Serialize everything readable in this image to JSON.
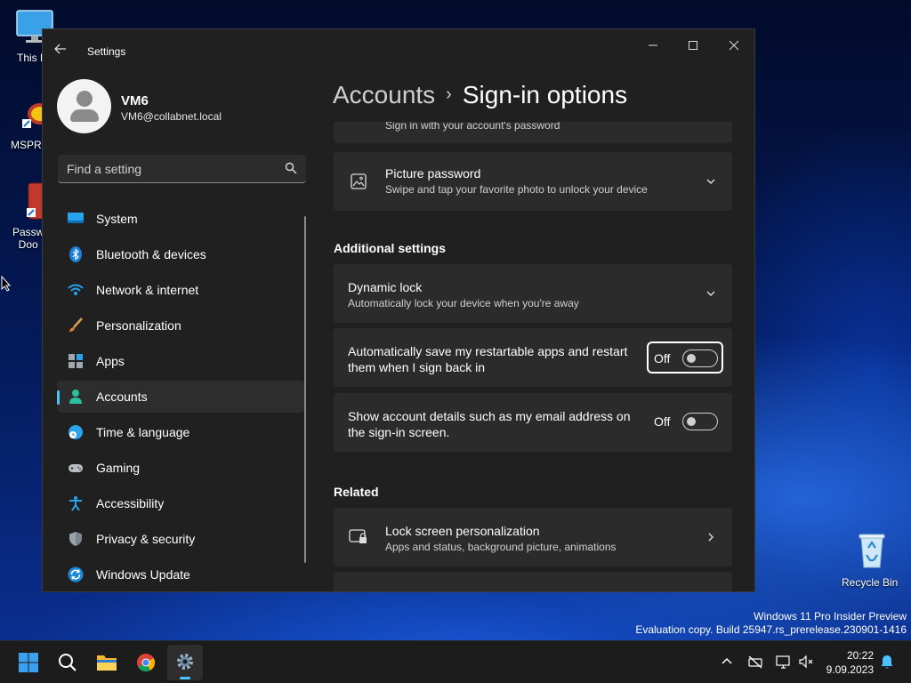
{
  "desktop": {
    "icons": [
      {
        "label": "This PC"
      },
      {
        "label": "MSPRe"
      },
      {
        "label": "Passw\nDoo"
      },
      {
        "label": "Recycle Bin"
      }
    ],
    "watermark_line1": "Windows 11 Pro Insider Preview",
    "watermark_line2": "Evaluation copy. Build 25947.rs_prerelease.230901-1416"
  },
  "window": {
    "app_title": "Settings",
    "controls": {
      "minimize": "─",
      "maximize": "☐",
      "close": "✕"
    }
  },
  "user": {
    "name": "VM6",
    "email": "VM6@collabnet.local"
  },
  "search": {
    "placeholder": "Find a setting"
  },
  "nav": {
    "items": [
      {
        "label": "System",
        "icon": "system-icon"
      },
      {
        "label": "Bluetooth & devices",
        "icon": "bluetooth-icon"
      },
      {
        "label": "Network & internet",
        "icon": "network-icon"
      },
      {
        "label": "Personalization",
        "icon": "brush-icon"
      },
      {
        "label": "Apps",
        "icon": "apps-icon"
      },
      {
        "label": "Accounts",
        "icon": "accounts-icon",
        "active": true
      },
      {
        "label": "Time & language",
        "icon": "globe-icon"
      },
      {
        "label": "Gaming",
        "icon": "gamepad-icon"
      },
      {
        "label": "Accessibility",
        "icon": "accessibility-icon"
      },
      {
        "label": "Privacy & security",
        "icon": "shield-icon"
      },
      {
        "label": "Windows Update",
        "icon": "update-icon"
      }
    ]
  },
  "breadcrumb": {
    "parent": "Accounts",
    "separator": "›",
    "current": "Sign-in options"
  },
  "content": {
    "password_card_sub": "Sign in with your account's password",
    "picture_password": {
      "title": "Picture password",
      "subtitle": "Swipe and tap your favorite photo to unlock your device"
    },
    "additional_settings_title": "Additional settings",
    "dynamic_lock": {
      "title": "Dynamic lock",
      "subtitle": "Automatically lock your device when you're away"
    },
    "restart_apps": {
      "title_line1": "Automatically save my restartable apps and restart",
      "title_line2": "them when I sign back in",
      "state": "Off"
    },
    "account_details": {
      "title_line1": "Show account details such as my email address on",
      "title_line2": "the sign-in screen.",
      "state": "Off"
    },
    "related_title": "Related",
    "lock_screen": {
      "title": "Lock screen personalization",
      "subtitle": "Apps and status, background picture, animations"
    }
  },
  "taskbar": {
    "time": "20:22",
    "date": "9.09.2023"
  },
  "colors": {
    "accent": "#4cc2ff",
    "window_bg": "#202020",
    "card_bg": "#2b2b2b"
  }
}
